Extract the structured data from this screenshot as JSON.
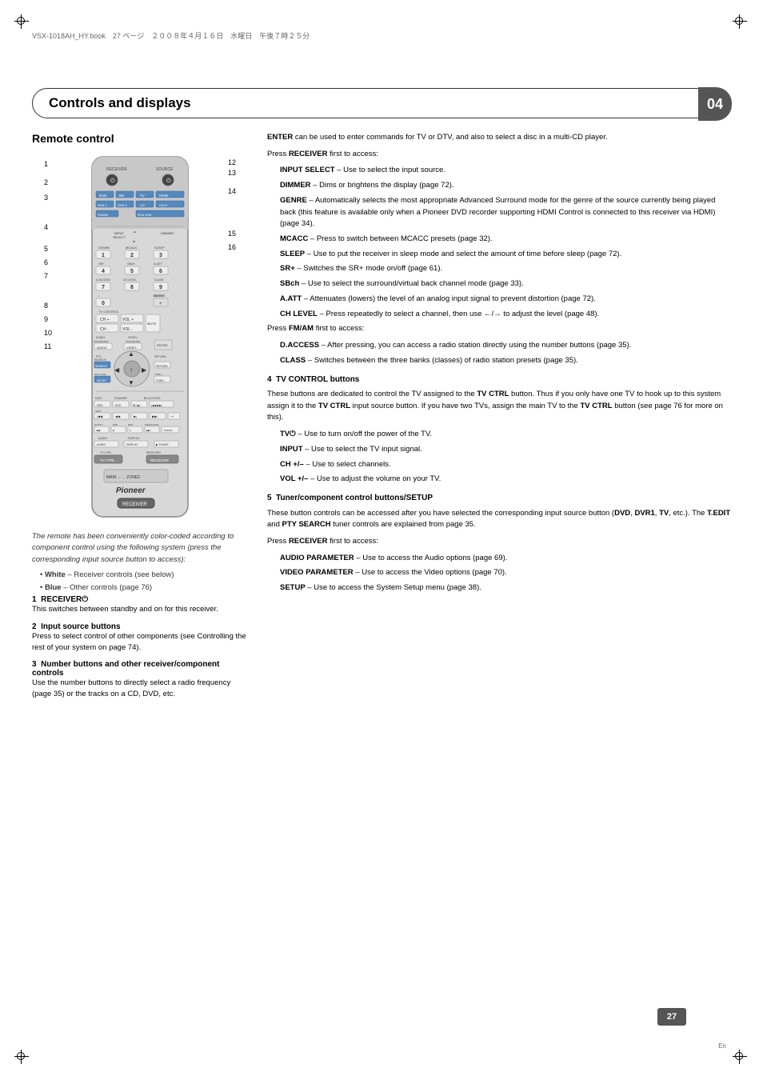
{
  "meta": {
    "book_ref": "VSX-1018AH_HY.book　27 ページ　２００８年４月１６日　水曜日　午後７時２５分",
    "chapter": "04",
    "title": "Controls and displays",
    "page_num": "27",
    "page_en": "En"
  },
  "left": {
    "section_title": "Remote control",
    "remote_caption": "The remote has been conveniently color-coded according to component control using the following system (press the corresponding input source button to access):",
    "bullets": [
      "White – Receiver controls (see below)",
      "Blue – Other controls (page 76)"
    ],
    "callout_numbers": [
      "1",
      "2",
      "3",
      "4",
      "5",
      "6",
      "7",
      "8",
      "9",
      "10",
      "11",
      "12",
      "13",
      "14",
      "15",
      "16"
    ],
    "sections": [
      {
        "num": "1",
        "title": "RECEIVER⏻",
        "body": "This switches between standby and on for this receiver."
      },
      {
        "num": "2",
        "title": "Input source buttons",
        "body": "Press to select control of other components (see Controlling the rest of your system on page 74)."
      },
      {
        "num": "3",
        "title": "Number buttons and other receiver/component controls",
        "body": "Use the number buttons to directly select a radio frequency (page 35) or the tracks on a CD, DVD, etc."
      }
    ]
  },
  "right": {
    "enter_text": "ENTER can be used to enter commands for TV or DTV, and also to select a disc in a multi-CD player.",
    "press_receiver": "Press RECEIVER first to access:",
    "receiver_items": [
      {
        "label": "INPUT SELECT",
        "dash": "–",
        "text": "Use to select the input source."
      },
      {
        "label": "DIMMER",
        "dash": "–",
        "text": "Dims or brightens the display (page 72)."
      },
      {
        "label": "GENRE",
        "dash": "–",
        "text": "Automatically selects the most appropriate Advanced Surround mode for the genre of the source currently being played back (this feature is available only when a Pioneer DVD recorder supporting HDMI Control is connected to this receiver via HDMI) (page 34)."
      },
      {
        "label": "MCACC",
        "dash": "–",
        "text": "Press to switch between MCACC presets (page 32)."
      },
      {
        "label": "SLEEP",
        "dash": "–",
        "text": "Use to put the receiver in sleep mode and select the amount of time before sleep (page 72)."
      },
      {
        "label": "SR+",
        "dash": "–",
        "text": "Switches the SR+ mode on/off (page 61)."
      },
      {
        "label": "SBch",
        "dash": "–",
        "text": "Use to select the surround/virtual back channel mode (page 33)."
      },
      {
        "label": "A.ATT",
        "dash": "–",
        "text": "Attenuates (lowers) the level of an analog input signal to prevent distortion (page 72)."
      },
      {
        "label": "CH LEVEL",
        "dash": "–",
        "text": "Press repeatedly to select a channel, then use ←/→ to adjust the level (page 48)."
      }
    ],
    "press_fmam": "Press FM/AM first to access:",
    "fmam_items": [
      {
        "label": "D.ACCESS",
        "dash": "–",
        "text": "After pressing, you can access a radio station directly using the number buttons (page 35)."
      },
      {
        "label": "CLASS",
        "dash": "–",
        "text": "Switches between the three banks (classes) of radio station presets (page 35)."
      }
    ],
    "section4": {
      "num": "4",
      "title": "TV CONTROL buttons",
      "body": "These buttons are dedicated to control the TV assigned to the TV CTRL button. Thus if you only have one TV to hook up to this system assign it to the TV CTRL input source button. If you have two TVs, assign the main TV to the TV CTRL button (see page 76 for more on this).",
      "items": [
        {
          "label": "TV⏻",
          "dash": "–",
          "text": "Use to turn on/off the power of the TV."
        },
        {
          "label": "INPUT",
          "dash": "–",
          "text": "Use to select the TV input signal."
        },
        {
          "label": "CH +/–",
          "dash": "–",
          "text": "Use to select channels."
        },
        {
          "label": "VOL +/–",
          "dash": "–",
          "text": "Use to adjust the volume on your TV."
        }
      ]
    },
    "section5": {
      "num": "5",
      "title": "Tuner/component control buttons/SETUP",
      "body": "These button controls can be accessed after you have selected the corresponding input source button (DVD, DVR1, TV, etc.). The T.EDIT and PTY SEARCH tuner controls are explained from page 35.",
      "press": "Press RECEIVER first to access:",
      "items": [
        {
          "label": "AUDIO PARAMETER",
          "dash": "–",
          "text": "Use to access the Audio options (page 69)."
        },
        {
          "label": "VIDEO PARAMETER",
          "dash": "–",
          "text": "Use to access the Video options (page 70)."
        },
        {
          "label": "SETUP",
          "dash": "–",
          "text": "Use to access the System Setup menu (page 38)."
        }
      ]
    }
  }
}
